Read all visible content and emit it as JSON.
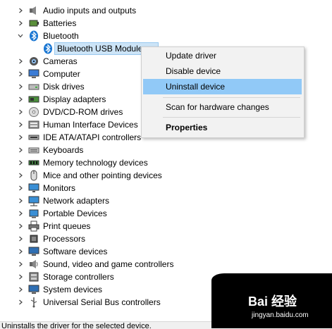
{
  "tree": [
    {
      "label": "Audio inputs and outputs",
      "icon": "speaker-icon",
      "expanded": false
    },
    {
      "label": "Batteries",
      "icon": "battery-icon",
      "expanded": false
    },
    {
      "label": "Bluetooth",
      "icon": "bluetooth-icon",
      "expanded": true
    },
    {
      "label": "Bluetooth USB Module",
      "icon": "bluetooth-icon",
      "child": true,
      "selected": true
    },
    {
      "label": "Cameras",
      "icon": "camera-icon",
      "expanded": false
    },
    {
      "label": "Computer",
      "icon": "computer-icon",
      "expanded": false
    },
    {
      "label": "Disk drives",
      "icon": "disk-drive-icon",
      "expanded": false
    },
    {
      "label": "Display adapters",
      "icon": "display-adapter-icon",
      "expanded": false
    },
    {
      "label": "DVD/CD-ROM drives",
      "icon": "dvd-drive-icon",
      "expanded": false
    },
    {
      "label": "Human Interface Devices",
      "icon": "hid-icon",
      "expanded": false
    },
    {
      "label": "IDE ATA/ATAPI controllers",
      "icon": "ide-controller-icon",
      "expanded": false
    },
    {
      "label": "Keyboards",
      "icon": "keyboard-icon",
      "expanded": false
    },
    {
      "label": "Memory technology devices",
      "icon": "memory-icon",
      "expanded": false
    },
    {
      "label": "Mice and other pointing devices",
      "icon": "mouse-icon",
      "expanded": false
    },
    {
      "label": "Monitors",
      "icon": "monitor-icon",
      "expanded": false
    },
    {
      "label": "Network adapters",
      "icon": "network-adapter-icon",
      "expanded": false
    },
    {
      "label": "Portable Devices",
      "icon": "portable-device-icon",
      "expanded": false
    },
    {
      "label": "Print queues",
      "icon": "printer-icon",
      "expanded": false
    },
    {
      "label": "Processors",
      "icon": "processor-icon",
      "expanded": false
    },
    {
      "label": "Software devices",
      "icon": "software-device-icon",
      "expanded": false
    },
    {
      "label": "Sound, video and game controllers",
      "icon": "sound-icon",
      "expanded": false
    },
    {
      "label": "Storage controllers",
      "icon": "storage-controller-icon",
      "expanded": false
    },
    {
      "label": "System devices",
      "icon": "system-device-icon",
      "expanded": false
    },
    {
      "label": "Universal Serial Bus controllers",
      "icon": "usb-icon",
      "expanded": false
    }
  ],
  "context_menu": {
    "update_driver": "Update driver",
    "disable_device": "Disable device",
    "uninstall_device": "Uninstall device",
    "scan_hardware": "Scan for hardware changes",
    "properties": "Properties"
  },
  "status_bar": "Uninstalls the driver for the selected device.",
  "watermark": {
    "brand": "Bai 经验",
    "site": "jingyan.baidu.com"
  },
  "colors": {
    "highlight": "#91c9f7",
    "selection": "#cce4f7",
    "bluetooth": "#1976d2"
  }
}
